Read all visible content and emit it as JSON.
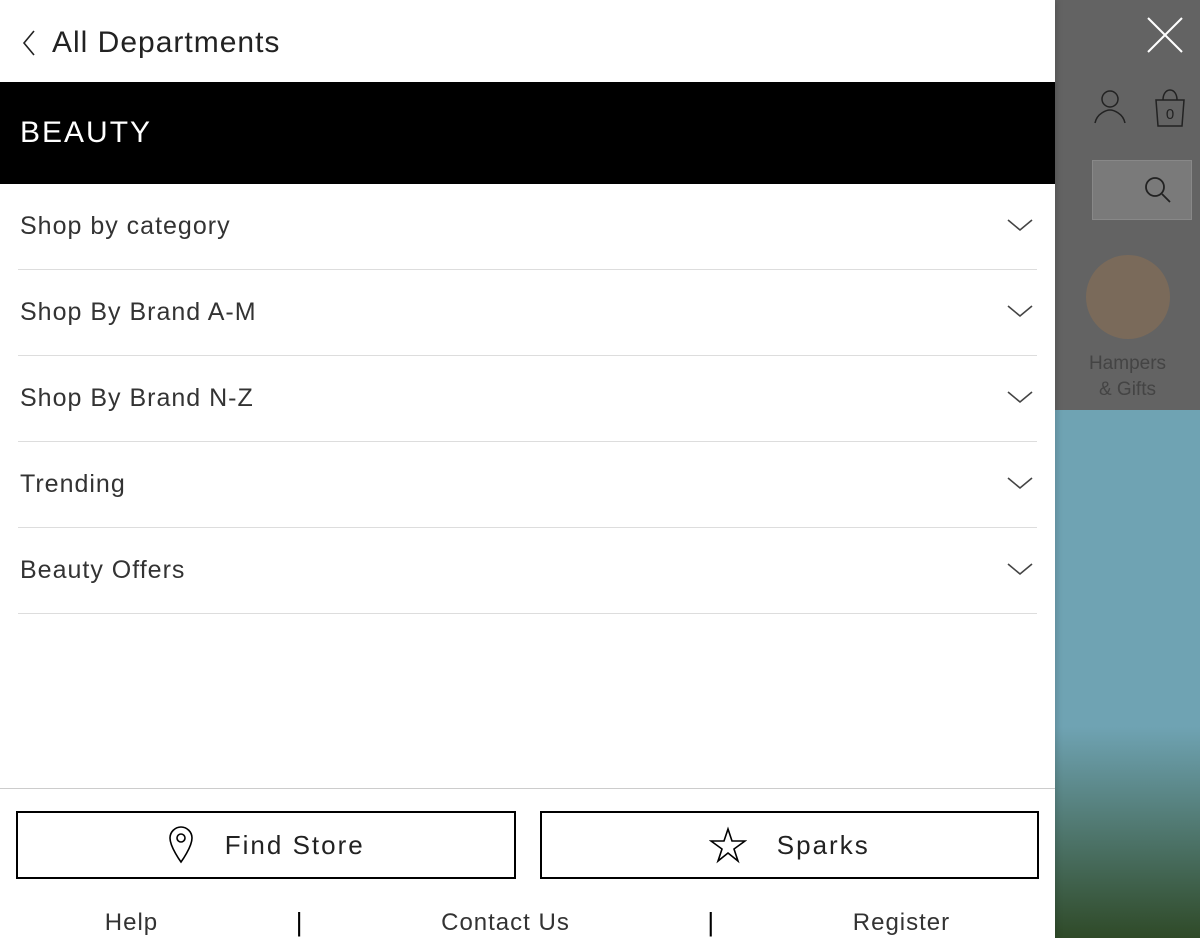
{
  "back": {
    "label": "All Departments"
  },
  "header": {
    "title": "BEAUTY"
  },
  "menu": {
    "items": [
      {
        "label": "Shop by category"
      },
      {
        "label": "Shop By Brand A-M"
      },
      {
        "label": "Shop By Brand N-Z"
      },
      {
        "label": "Trending"
      },
      {
        "label": "Beauty Offers"
      }
    ]
  },
  "buttons": {
    "find_store": "Find Store",
    "sparks": "Sparks"
  },
  "footer_links": {
    "help": "Help",
    "contact": "Contact Us",
    "register": "Register"
  },
  "backdrop": {
    "bag_count": "0",
    "promo_line1": "Hampers",
    "promo_line2": "& Gifts"
  }
}
